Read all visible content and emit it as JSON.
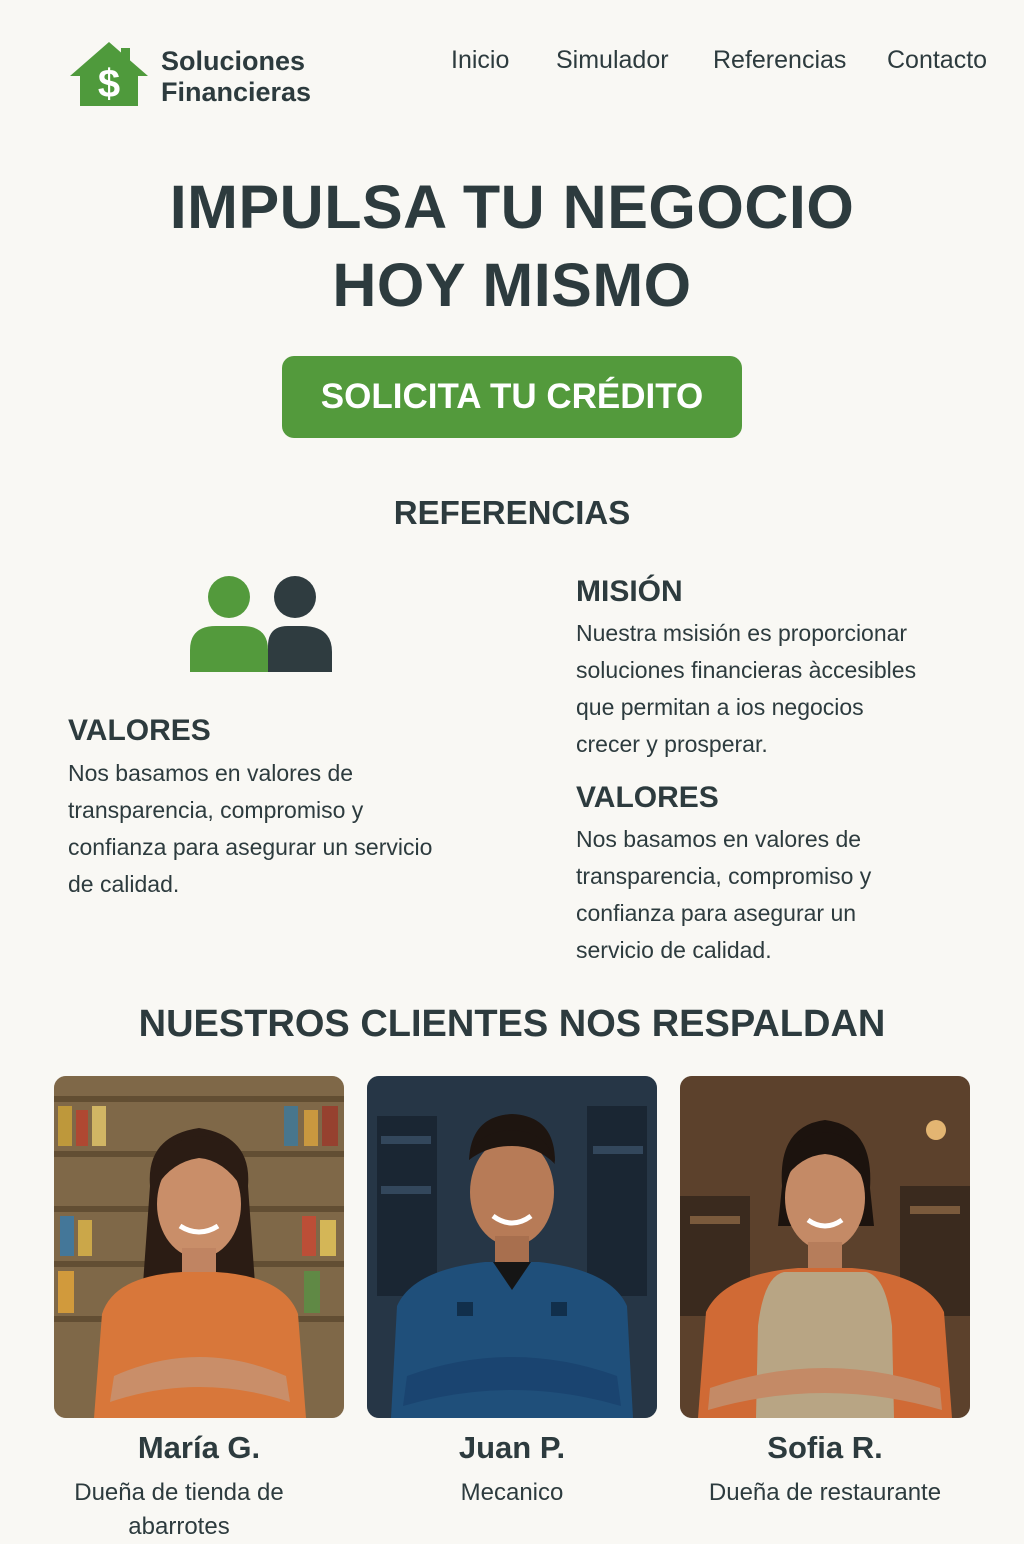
{
  "header": {
    "brand_line1": "Soluciones",
    "brand_line2": "Financieras",
    "logo_icon": "house-dollar-icon",
    "nav": [
      "Inicio",
      "Simulador",
      "Referencias",
      "Contacto"
    ]
  },
  "hero": {
    "line1": "IMPULSA TU NEGOCIO",
    "line2": "HOY MISMO",
    "cta_label": "SOLICITA TU CRÉDITO"
  },
  "references": {
    "title": "REFERENCIAS",
    "icon": "people-icon",
    "left": {
      "heading": "VALORES",
      "lines": [
        "Nos basamos en valores de",
        "transparencia, compromiso y",
        "confianza para asegurar un servicio",
        "de calidad."
      ]
    },
    "mision": {
      "heading": "MISIÓN",
      "lines": [
        "Nuestra msisión es proporcionar",
        "soluciones financieras àccesibles",
        "que permitan a ios negocios",
        "crecer y prosperar."
      ]
    },
    "valores": {
      "heading": "VALORES",
      "lines": [
        "Nos basamos en valores de",
        "transparencia, compromiso y",
        "confianza para asegurar un",
        "servicio de calidad."
      ]
    }
  },
  "testimonials": {
    "title": "NUESTROS CLIENTES NOS RESPALDAN",
    "clients": [
      {
        "name": "María G.",
        "role_lines": [
          "Dueña de tienda de",
          "abarrotes"
        ]
      },
      {
        "name": "Juan P.",
        "role_lines": [
          "Mecanico"
        ]
      },
      {
        "name": "Sofia R.",
        "role_lines": [
          "Dueña de restaurante"
        ]
      }
    ]
  },
  "colors": {
    "accent_green": "#539a3c",
    "dark_text": "#2d3b3e",
    "background": "#f9f8f4"
  }
}
